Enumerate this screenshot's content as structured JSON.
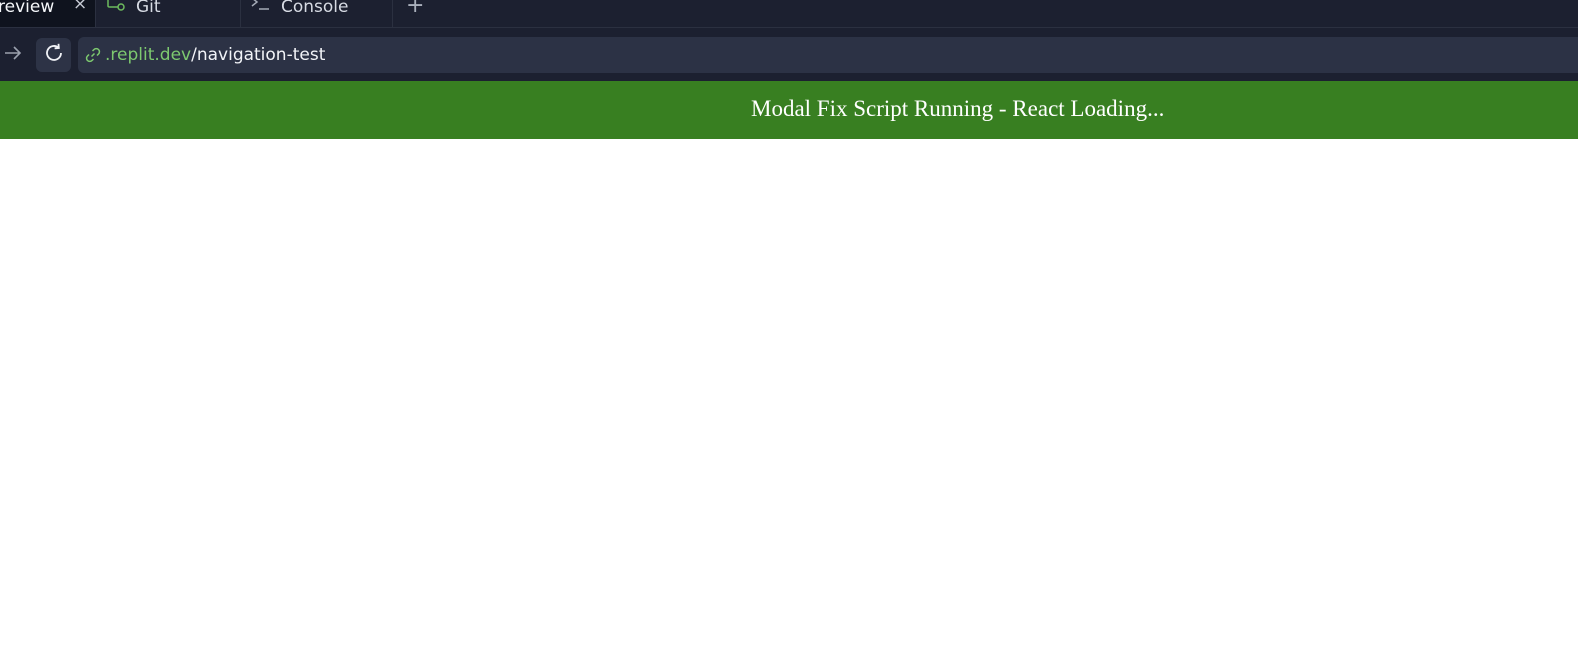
{
  "tabs": [
    {
      "label": "review",
      "icon": "preview-tab",
      "active": true,
      "closable": true
    },
    {
      "label": "Git",
      "icon": "git-branch-icon",
      "active": false
    },
    {
      "label": "Console",
      "icon": "terminal-icon",
      "active": false
    }
  ],
  "new_tab_glyph": "+",
  "close_glyph": "×",
  "address": {
    "domain": ".replit.dev",
    "path": "/navigation-test"
  },
  "banner": {
    "text": "Modal Fix Script Running - React Loading...",
    "background": "#387f21",
    "color": "#ffffff"
  },
  "colors": {
    "chrome_bg": "#1c2030",
    "url_bg": "#2c3245",
    "domain_green": "#7dc96f"
  }
}
